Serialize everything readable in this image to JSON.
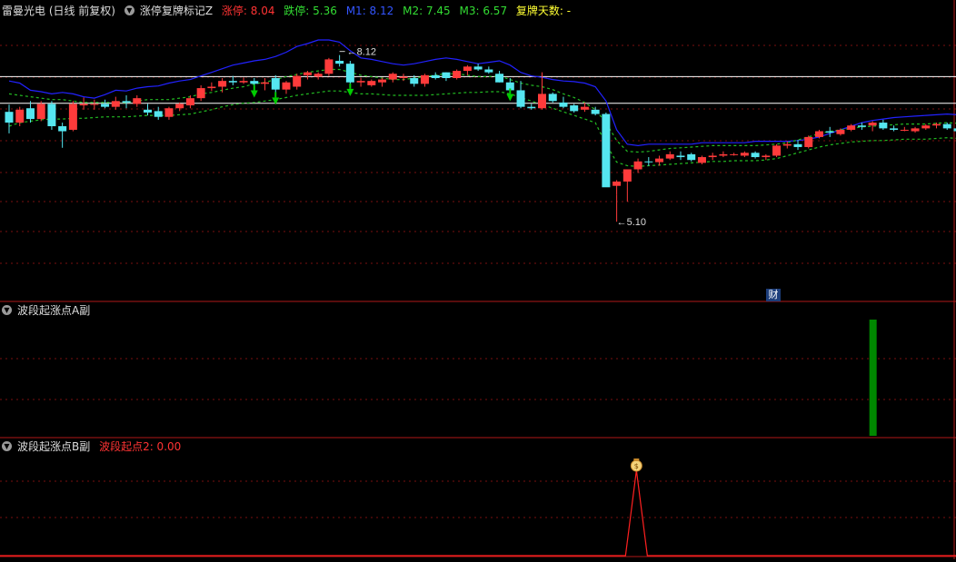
{
  "header1": {
    "stock": "雷曼光电 (日线 前复权)",
    "indicator": "涨停复牌标记Z",
    "items": [
      {
        "label": "涨停: 8.04",
        "color": "#ff3333"
      },
      {
        "label": "跌停: 5.36",
        "color": "#33dd33"
      },
      {
        "label": "M1: 8.12",
        "color": "#3355ff"
      },
      {
        "label": "M2: 7.45",
        "color": "#33dd33"
      },
      {
        "label": "M3: 6.57",
        "color": "#33dd33"
      },
      {
        "label": "复牌天数: -",
        "color": "#ffff33"
      }
    ]
  },
  "header2": {
    "indicator": "波段起涨点A副"
  },
  "header3": {
    "indicator": "波段起涨点B副",
    "value": "波段起点2: 0.00",
    "value_color": "#ff3333"
  },
  "annotations": {
    "high": "8.12",
    "low": "5.10",
    "badge": "财"
  },
  "colors": {
    "up": "#ff3b3b",
    "down": "#55e6f0",
    "upper_band": "#2222ff",
    "bands": "#22bb22",
    "grid": "#7a1010",
    "divider": "#b01818",
    "level_line": "#ffffff",
    "signal_bar": "#008800",
    "signal_line": "#ff2020",
    "arrow": "#00cc00"
  },
  "icons": {
    "collapse": "chevron-down-icon",
    "signal": "money-bag-icon"
  },
  "chart_data": {
    "type": "candlestick",
    "levels": {
      "limit_up": 8.04,
      "limit_down": 5.36
    },
    "candles": [
      [
        7.55,
        7.65,
        7.25,
        7.4
      ],
      [
        7.4,
        7.62,
        7.35,
        7.58
      ],
      [
        7.6,
        7.7,
        7.4,
        7.45
      ],
      [
        7.45,
        7.7,
        7.42,
        7.66
      ],
      [
        7.66,
        7.7,
        7.3,
        7.35
      ],
      [
        7.35,
        7.4,
        7.05,
        7.28
      ],
      [
        7.3,
        7.7,
        7.28,
        7.66
      ],
      [
        7.64,
        7.75,
        7.58,
        7.66
      ],
      [
        7.66,
        7.72,
        7.58,
        7.66
      ],
      [
        7.66,
        7.72,
        7.6,
        7.62
      ],
      [
        7.62,
        7.76,
        7.58,
        7.7
      ],
      [
        7.7,
        7.78,
        7.6,
        7.68
      ],
      [
        7.66,
        7.78,
        7.62,
        7.74
      ],
      [
        7.58,
        7.66,
        7.5,
        7.54
      ],
      [
        7.56,
        7.62,
        7.44,
        7.48
      ],
      [
        7.48,
        7.62,
        7.44,
        7.6
      ],
      [
        7.6,
        7.68,
        7.56,
        7.66
      ],
      [
        7.64,
        7.78,
        7.6,
        7.74
      ],
      [
        7.74,
        7.92,
        7.7,
        7.88
      ],
      [
        7.88,
        7.96,
        7.84,
        7.9
      ],
      [
        7.9,
        8.02,
        7.82,
        7.98
      ],
      [
        7.98,
        8.05,
        7.92,
        7.96
      ],
      [
        7.96,
        8.03,
        7.94,
        7.98
      ],
      [
        7.98,
        8.02,
        7.9,
        7.94
      ],
      [
        7.94,
        8.02,
        7.85,
        7.96
      ],
      [
        8.02,
        8.06,
        7.8,
        7.86
      ],
      [
        7.86,
        7.98,
        7.8,
        7.96
      ],
      [
        7.9,
        8.08,
        7.86,
        8.05
      ],
      [
        8.06,
        8.12,
        8.0,
        8.1
      ],
      [
        8.04,
        8.1,
        8.0,
        8.08
      ],
      [
        8.08,
        8.3,
        8.05,
        8.28
      ],
      [
        8.26,
        8.34,
        8.18,
        8.22
      ],
      [
        8.22,
        8.26,
        7.92,
        7.96
      ],
      [
        7.96,
        8.02,
        7.9,
        7.98
      ],
      [
        7.92,
        8.0,
        7.9,
        7.98
      ],
      [
        7.96,
        8.02,
        7.9,
        8.0
      ],
      [
        8.0,
        8.1,
        7.96,
        8.08
      ],
      [
        8.02,
        8.08,
        7.98,
        8.04
      ],
      [
        8.02,
        8.06,
        7.9,
        7.94
      ],
      [
        7.94,
        8.08,
        7.9,
        8.06
      ],
      [
        8.06,
        8.1,
        8.0,
        8.02
      ],
      [
        8.1,
        8.1,
        7.98,
        8.02
      ],
      [
        8.02,
        8.14,
        8.0,
        8.12
      ],
      [
        8.12,
        8.2,
        8.06,
        8.18
      ],
      [
        8.18,
        8.22,
        8.12,
        8.14
      ],
      [
        8.14,
        8.18,
        8.08,
        8.1
      ],
      [
        8.08,
        8.12,
        7.96,
        7.96
      ],
      [
        7.96,
        8.02,
        7.85,
        7.85
      ],
      [
        7.85,
        7.98,
        7.6,
        7.62
      ],
      [
        7.62,
        7.66,
        7.58,
        7.6
      ],
      [
        7.6,
        8.1,
        7.58,
        7.8
      ],
      [
        7.8,
        7.82,
        7.68,
        7.7
      ],
      [
        7.68,
        7.76,
        7.6,
        7.62
      ],
      [
        7.64,
        7.66,
        7.54,
        7.56
      ],
      [
        7.58,
        7.68,
        7.55,
        7.62
      ],
      [
        7.58,
        7.62,
        7.5,
        7.52
      ],
      [
        7.52,
        7.54,
        7.3,
        6.5
      ],
      [
        6.52,
        6.6,
        6.4,
        6.58
      ],
      [
        6.58,
        6.75,
        6.3,
        6.75
      ],
      [
        6.75,
        6.9,
        6.7,
        6.86
      ],
      [
        6.86,
        6.92,
        6.8,
        6.85
      ],
      [
        6.85,
        6.94,
        6.8,
        6.9
      ],
      [
        6.9,
        7.0,
        6.88,
        6.96
      ],
      [
        6.94,
        7.0,
        6.88,
        6.92
      ],
      [
        6.96,
        6.98,
        6.86,
        6.88
      ],
      [
        6.84,
        6.94,
        6.82,
        6.92
      ],
      [
        6.92,
        6.98,
        6.88,
        6.94
      ],
      [
        6.94,
        7.0,
        6.92,
        6.96
      ],
      [
        6.96,
        6.98,
        6.94,
        6.96
      ],
      [
        6.94,
        7.0,
        6.92,
        6.98
      ],
      [
        6.98,
        7.0,
        6.9,
        6.92
      ],
      [
        6.92,
        6.96,
        6.88,
        6.94
      ],
      [
        6.94,
        7.1,
        6.92,
        7.08
      ],
      [
        7.08,
        7.14,
        7.04,
        7.1
      ],
      [
        7.1,
        7.16,
        7.02,
        7.06
      ],
      [
        7.06,
        7.22,
        7.04,
        7.2
      ],
      [
        7.2,
        7.3,
        7.18,
        7.28
      ],
      [
        7.28,
        7.34,
        7.2,
        7.26
      ],
      [
        7.24,
        7.32,
        7.22,
        7.3
      ],
      [
        7.3,
        7.38,
        7.28,
        7.36
      ],
      [
        7.36,
        7.4,
        7.3,
        7.34
      ],
      [
        7.36,
        7.42,
        7.28,
        7.4
      ],
      [
        7.4,
        7.44,
        7.3,
        7.32
      ],
      [
        7.32,
        7.36,
        7.28,
        7.3
      ],
      [
        7.3,
        7.34,
        7.28,
        7.3
      ],
      [
        7.28,
        7.34,
        7.26,
        7.32
      ],
      [
        7.32,
        7.38,
        7.3,
        7.36
      ],
      [
        7.36,
        7.4,
        7.32,
        7.38
      ],
      [
        7.38,
        7.4,
        7.3,
        7.32
      ],
      [
        7.32,
        7.34,
        7.24,
        7.28
      ],
      [
        7.28,
        7.32,
        7.24,
        7.3
      ]
    ],
    "M1_upper": [
      7.98,
      7.95,
      7.85,
      7.83,
      7.8,
      7.82,
      7.8,
      7.76,
      7.74,
      7.79,
      7.85,
      7.84,
      7.88,
      7.9,
      7.91,
      7.95,
      7.98,
      8.0,
      8.05,
      8.1,
      8.15,
      8.2,
      8.23,
      8.26,
      8.28,
      8.32,
      8.38,
      8.46,
      8.5,
      8.55,
      8.55,
      8.52,
      8.4,
      8.3,
      8.28,
      8.25,
      8.22,
      8.2,
      8.22,
      8.25,
      8.28,
      8.3,
      8.28,
      8.25,
      8.22,
      8.24,
      8.26,
      8.2,
      8.1,
      8.05,
      8.03,
      8.0,
      7.98,
      7.97,
      7.95,
      7.9,
      7.7,
      7.3,
      7.1,
      7.08,
      7.1,
      7.1,
      7.1,
      7.1,
      7.1,
      7.12,
      7.12,
      7.12,
      7.12,
      7.12,
      7.14,
      7.14,
      7.14,
      7.14,
      7.15,
      7.17,
      7.2,
      7.25,
      7.3,
      7.35,
      7.4,
      7.43,
      7.45,
      7.47,
      7.48,
      7.49,
      7.5,
      7.51,
      7.52,
      7.51,
      7.5
    ],
    "M2_mid": [
      7.8,
      7.78,
      7.76,
      7.74,
      7.72,
      7.72,
      7.7,
      7.68,
      7.68,
      7.68,
      7.68,
      7.68,
      7.7,
      7.72,
      7.72,
      7.72,
      7.74,
      7.76,
      7.8,
      7.82,
      7.85,
      7.88,
      7.9,
      7.94,
      7.96,
      8.0,
      8.04,
      8.07,
      8.1,
      8.12,
      8.14,
      8.14,
      8.1,
      8.06,
      8.04,
      8.02,
      8.0,
      8.0,
      8.02,
      8.04,
      8.06,
      8.08,
      8.08,
      8.06,
      8.04,
      8.04,
      8.05,
      8.0,
      7.95,
      7.92,
      7.9,
      7.86,
      7.8,
      7.75,
      7.68,
      7.58,
      7.4,
      7.15,
      7.0,
      6.99,
      7.0,
      7.02,
      7.04,
      7.05,
      7.06,
      7.07,
      7.08,
      7.08,
      7.08,
      7.08,
      7.08,
      7.09,
      7.1,
      7.12,
      7.16,
      7.2,
      7.25,
      7.28,
      7.3,
      7.32,
      7.34,
      7.35,
      7.36,
      7.37,
      7.38,
      7.38,
      7.38,
      7.39,
      7.4,
      7.39,
      7.38
    ],
    "M3_lower": [
      7.35,
      7.4,
      7.42,
      7.44,
      7.45,
      7.45,
      7.46,
      7.46,
      7.47,
      7.48,
      7.48,
      7.48,
      7.49,
      7.5,
      7.5,
      7.5,
      7.51,
      7.52,
      7.55,
      7.58,
      7.62,
      7.65,
      7.67,
      7.68,
      7.7,
      7.72,
      7.75,
      7.78,
      7.8,
      7.82,
      7.84,
      7.84,
      7.82,
      7.8,
      7.8,
      7.79,
      7.78,
      7.78,
      7.78,
      7.78,
      7.79,
      7.8,
      7.81,
      7.82,
      7.82,
      7.83,
      7.83,
      7.8,
      7.75,
      7.7,
      7.65,
      7.6,
      7.55,
      7.5,
      7.45,
      7.4,
      7.1,
      6.85,
      6.8,
      6.79,
      6.8,
      6.81,
      6.82,
      6.83,
      6.84,
      6.85,
      6.86,
      6.86,
      6.87,
      6.87,
      6.87,
      6.88,
      6.9,
      6.94,
      6.98,
      7.02,
      7.06,
      7.09,
      7.11,
      7.13,
      7.14,
      7.15,
      7.15,
      7.16,
      7.17,
      7.17,
      7.17,
      7.18,
      7.19,
      7.18,
      7.17
    ],
    "arrow_indices": [
      23,
      25,
      32,
      47
    ],
    "high_index": 31,
    "low_index": 57,
    "signal_A_index": 79,
    "signal_B_index": 58,
    "signal_B_peak": 2.0
  }
}
